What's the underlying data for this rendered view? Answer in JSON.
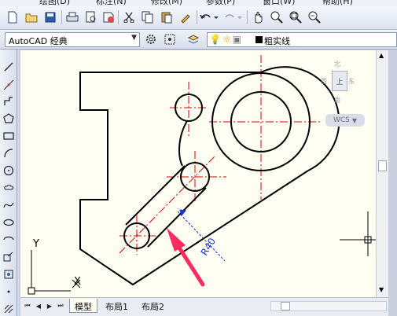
{
  "menubar": {
    "items": [
      "绘图(D)",
      "标注(N)",
      "修改(M)",
      "参数(P)",
      "窗口(W)",
      "帮助(H)"
    ]
  },
  "toolbar": {
    "icons": [
      "new-icon",
      "open-icon",
      "save-icon",
      "print-icon",
      "print-preview-icon",
      "publish-icon",
      "cut-icon",
      "copy-icon",
      "paste-icon",
      "match-properties-icon",
      "undo-icon",
      "redo-icon",
      "pan-icon",
      "zoom-realtime-icon",
      "zoom-window-icon",
      "zoom-previous-icon"
    ]
  },
  "workspace": {
    "selected": "AutoCAD 经典"
  },
  "layer": {
    "name": "粗实线",
    "swatch_color": "#000000"
  },
  "viewcube": {
    "north": "北",
    "south": "南",
    "west": "西",
    "east": "东",
    "face": "上",
    "ucs_label": "WCS"
  },
  "drawing": {
    "dimension_text": "R40",
    "ucs_x": "X",
    "ucs_y": "Y",
    "colors": {
      "outline": "#000000",
      "centerline": "#e00000",
      "dimension": "#1a33d6",
      "arrow": "#ff2a5f",
      "background": "#fffef2"
    }
  },
  "tabs": {
    "items": [
      "模型",
      "布局1",
      "布局2"
    ],
    "active": "模型"
  }
}
